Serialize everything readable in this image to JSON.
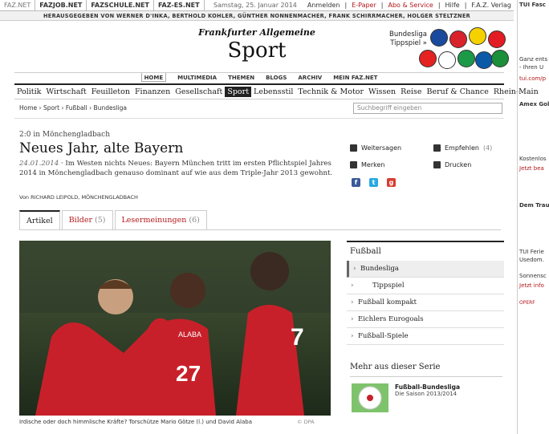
{
  "topbar": {
    "links": [
      "FAZ.NET",
      "FAZJOB.NET",
      "FAZSCHULE.NET",
      "FAZ-ES.NET"
    ],
    "date": "Samstag, 25. Januar 2014",
    "right": [
      "Anmelden",
      "E-Paper",
      "Abo & Service",
      "Hilfe",
      "F.A.Z. Verlag"
    ]
  },
  "masthead": {
    "publisher_line": "HERAUSGEGEBEN VON WERNER D'INKA, BERTHOLD KOHLER, GÜNTHER NONNENMACHER, FRANK SCHIRRMACHER, HOLGER STELTZNER",
    "logo": "Frankfurter Allgemeine",
    "section": "Sport",
    "bundesliga_line1": "Bundesliga",
    "bundesliga_line2": "Tippspiel »"
  },
  "nav_primary": [
    "HOME",
    "MULTIMEDIA",
    "THEMEN",
    "BLOGS",
    "ARCHIV",
    "MEIN FAZ.NET"
  ],
  "nav_sections": [
    "Politik",
    "Wirtschaft",
    "Feuilleton",
    "Finanzen",
    "Gesellschaft",
    "Sport",
    "Lebensstil",
    "Technik & Motor",
    "Wissen",
    "Reise",
    "Beruf & Chance",
    "Rhein-Main"
  ],
  "breadcrumb": [
    "Home",
    "Sport",
    "Fußball",
    "Bundesliga"
  ],
  "search": {
    "placeholder": "Suchbegriff eingeben"
  },
  "article": {
    "kicker": "2:0 in Mönchengladbach",
    "headline": "Neues Jahr, alte Bayern",
    "date": "24.01.2014",
    "teaser": " · Im Westen nichts Neues: Bayern München tritt im ersten Pflichtspiel Jahres 2014 in Mönchengladbach genauso dominant auf wie aus dem Triple-Jahr 2013 gewohnt.",
    "author": "Von RICHARD LEIPOLD, MÖNCHENGLADBACH"
  },
  "tools": {
    "share": "Weitersagen",
    "recommend": "Empfehlen",
    "recommend_count": "(4)",
    "save": "Merken",
    "print": "Drucken"
  },
  "tabs": [
    {
      "label": "Artikel",
      "count": ""
    },
    {
      "label": "Bilder",
      "count": "(5)"
    },
    {
      "label": "Lesermeinungen",
      "count": "(6)"
    }
  ],
  "photo": {
    "caption": "Irdische oder doch himmlische Kräfte? Torschütze Mario Götze (l.) und David Alaba",
    "credit": "© DPA",
    "jersey_left": "ALABA",
    "jersey_num": "27",
    "jersey_right": "7"
  },
  "right_nav": {
    "header": "Fußball",
    "items": [
      "Bundesliga",
      "Tippspiel",
      "Fußball kompakt",
      "Eichlers Eurogoals",
      "Fußball-Spiele"
    ]
  },
  "serie": {
    "header": "Mehr aus dieser Serie",
    "title": "Fußball-Bundesliga",
    "sub": "Die Saison 2013/2014"
  },
  "ad": {
    "lines": [
      "TUI Fasc",
      "Ganz ents",
      "- Ihren U",
      "tui.com/p",
      "Amex Gol",
      "Kostenlos",
      "Jetzt bea",
      "Dem Trau",
      "TUI Ferie",
      "Usedom.",
      "Sonnensc",
      "Jetzt info",
      "OPERF"
    ]
  },
  "colors": {
    "accent": "#b3171b",
    "dark": "#222222"
  }
}
